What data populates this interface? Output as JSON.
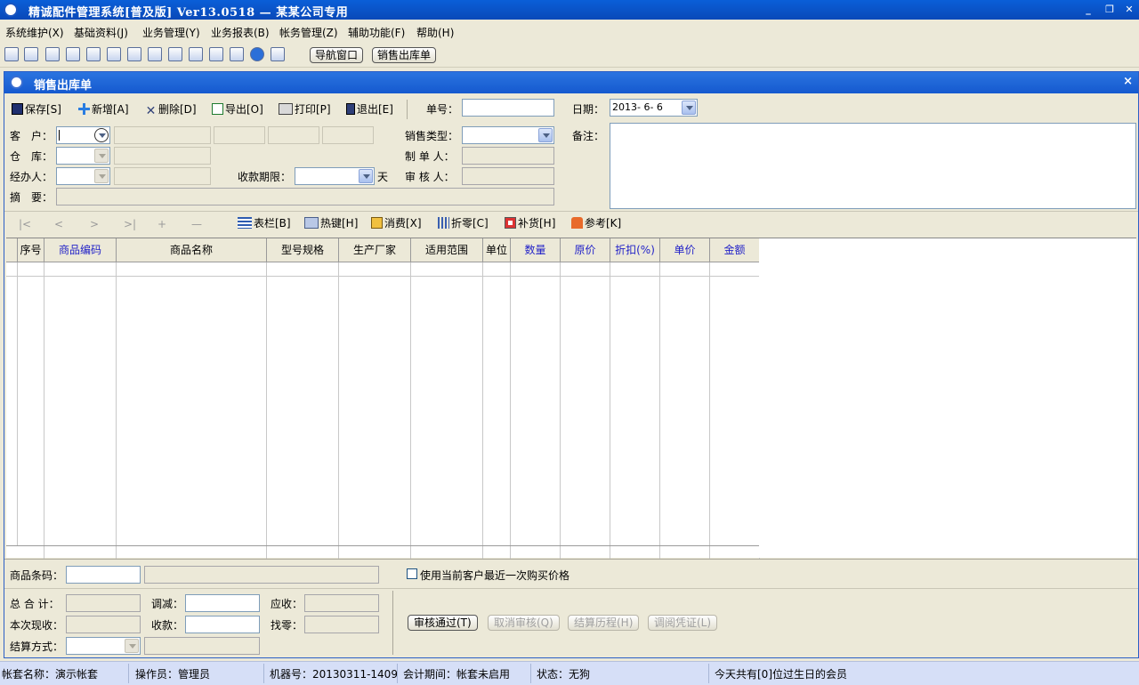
{
  "app": {
    "title": "精诚配件管理系统[普及版] Ver13.0518 — 某某公司专用",
    "min_label": "_",
    "restore_label": "❐",
    "close_label": "✕"
  },
  "menu": [
    "系统维护(X)",
    "基础资料(J)",
    "业务管理(Y)",
    "业务报表(B)",
    "帐务管理(Z)",
    "辅助功能(F)",
    "帮助(H)"
  ],
  "toolbar": {
    "nav_window": "导航窗口",
    "sales_out": "销售出库单"
  },
  "window": {
    "title": "销售出库单",
    "close": "×"
  },
  "actions": {
    "save": "保存[S]",
    "add": "新增[A]",
    "delete": "删除[D]",
    "export": "导出[O]",
    "print": "打印[P]",
    "exit": "退出[E]"
  },
  "form": {
    "order_no_label": "单号：",
    "order_no_value": "",
    "date_label": "日期：",
    "date_value": "2013- 6- 6",
    "customer_label": "客　户：",
    "warehouse_label": "仓　库：",
    "handler_label": "经办人：",
    "summary_label": "摘　要：",
    "payment_term_label": "收款期限：",
    "days_unit": "天",
    "sales_type_label": "销售类型：",
    "maker_label": "制 单 人：",
    "auditor_label": "审 核 人：",
    "remark_label": "备注："
  },
  "grid_toolbar": {
    "first": "|<",
    "prev": "<",
    "next": ">",
    "last": ">|",
    "add": "+",
    "remove": "—",
    "columns": "表栏[B]",
    "hotkeys": "热键[H]",
    "consume": "消费[X]",
    "split": "折零[C]",
    "restock": "补货[H]",
    "reference": "参考[K]"
  },
  "grid": {
    "columns": [
      {
        "label": "",
        "blue": false
      },
      {
        "label": "序号",
        "blue": false
      },
      {
        "label": "商品编码",
        "blue": true
      },
      {
        "label": "商品名称",
        "blue": false
      },
      {
        "label": "型号规格",
        "blue": false
      },
      {
        "label": "生产厂家",
        "blue": false
      },
      {
        "label": "适用范围",
        "blue": false
      },
      {
        "label": "单位",
        "blue": false
      },
      {
        "label": "数量",
        "blue": true
      },
      {
        "label": "原价",
        "blue": true
      },
      {
        "label": "折扣(%)",
        "blue": true
      },
      {
        "label": "单价",
        "blue": true
      },
      {
        "label": "金额",
        "blue": true
      }
    ]
  },
  "barcode": {
    "label": "商品条码：",
    "use_last_price": "使用当前客户最近一次购买价格"
  },
  "totals": {
    "total_label": "总 合 计：",
    "adjust_label": "调减：",
    "receivable_label": "应收：",
    "cash_label": "本次现收：",
    "received_label": "收款：",
    "change_label": "找零：",
    "settle_method_label": "结算方式："
  },
  "audit_buttons": {
    "approve": "审核通过(T)",
    "cancel_audit": "取消审核(Q)",
    "settle_history": "结算历程(H)",
    "view_voucher": "调阅凭证(L)"
  },
  "status": {
    "account_set": "帐套名称：演示帐套",
    "operator": "操作员：管理员",
    "machine": "机器号：20130311-1409",
    "period": "会计期间：帐套未启用",
    "state": "状态：无狗",
    "birthday": "今天共有[0]位过生日的会员"
  }
}
